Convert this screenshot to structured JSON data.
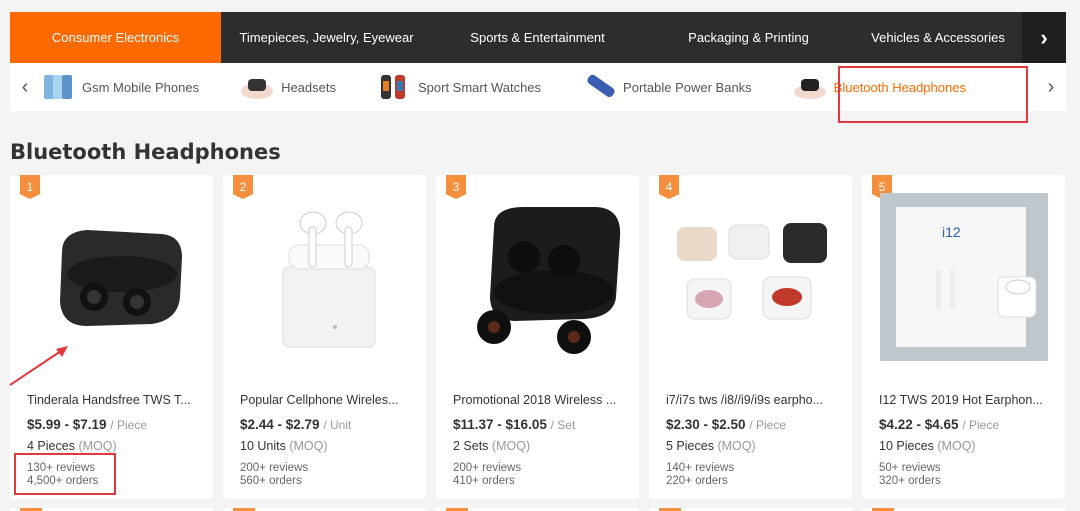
{
  "topnav": {
    "tabs": [
      {
        "label": "Consumer Electronics",
        "active": true
      },
      {
        "label": "Timepieces, Jewelry, Eyewear",
        "active": false
      },
      {
        "label": "Sports & Entertainment",
        "active": false
      },
      {
        "label": "Packaging & Printing",
        "active": false
      },
      {
        "label": "Vehicles & Accessories",
        "active": false
      }
    ]
  },
  "subnav": {
    "items": [
      {
        "label": "Gsm Mobile Phones",
        "icon": "phone-thumbnail"
      },
      {
        "label": "Headsets",
        "icon": "headset-thumbnail"
      },
      {
        "label": "Sport Smart Watches",
        "icon": "watch-thumbnail"
      },
      {
        "label": "Portable Power Banks",
        "icon": "powerbank-thumbnail"
      },
      {
        "label": "Bluetooth Headphones",
        "icon": "earbuds-thumbnail",
        "active": true
      }
    ]
  },
  "section_title": "Bluetooth Headphones",
  "products": [
    {
      "rank": "1",
      "title": "Tinderala Handsfree TWS T...",
      "price": "$5.99 - $7.19",
      "unit": "/ Piece",
      "moq_qty": "4 Pieces",
      "moq_label": "(MOQ)",
      "reviews": "130+ reviews",
      "orders": "4,500+ orders"
    },
    {
      "rank": "2",
      "title": "Popular Cellphone Wireles...",
      "price": "$2.44 - $2.79",
      "unit": "/ Unit",
      "moq_qty": "10 Units",
      "moq_label": "(MOQ)",
      "reviews": "200+ reviews",
      "orders": "560+ orders"
    },
    {
      "rank": "3",
      "title": "Promotional 2018 Wireless ...",
      "price": "$11.37 - $16.05",
      "unit": "/ Set",
      "moq_qty": "2 Sets",
      "moq_label": "(MOQ)",
      "reviews": "200+ reviews",
      "orders": "410+ orders"
    },
    {
      "rank": "4",
      "title": "i7/i7s tws /i8//i9/i9s earpho...",
      "price": "$2.30 - $2.50",
      "unit": "/ Piece",
      "moq_qty": "5 Pieces",
      "moq_label": "(MOQ)",
      "reviews": "140+ reviews",
      "orders": "220+ orders"
    },
    {
      "rank": "5",
      "title": "I12 TWS 2019 Hot Earphon...",
      "price": "$4.22 - $4.65",
      "unit": "/ Piece",
      "moq_qty": "10 Pieces",
      "moq_label": "(MOQ)",
      "reviews": "50+ reviews",
      "orders": "320+ orders",
      "box_text": "i12"
    }
  ],
  "colors": {
    "accent": "#ff6a00",
    "annotation": "#e0393e",
    "rank_badge": "#f58f3d",
    "nav_bg": "#2d2d2d"
  }
}
